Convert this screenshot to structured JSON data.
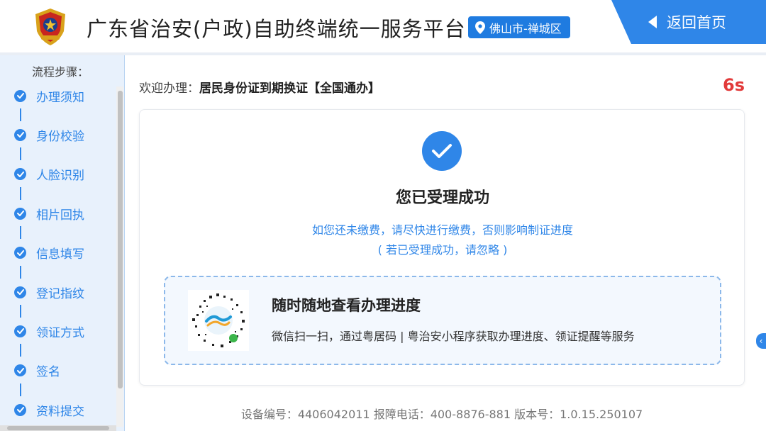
{
  "header": {
    "title": "广东省治安(户政)自助终端统一服务平台",
    "location": "佛山市-禅城区",
    "home_label": "返回首页",
    "icons": {
      "emblem": "police-emblem-icon",
      "location": "map-pin-icon",
      "back": "triangle-left-icon"
    },
    "colors": {
      "accent": "#2f86e8",
      "badge": "#1f7be0"
    }
  },
  "sidebar": {
    "heading": "流程步骤：",
    "steps": [
      {
        "label": "办理须知",
        "done": true
      },
      {
        "label": "身份校验",
        "done": true
      },
      {
        "label": "人脸识别",
        "done": true
      },
      {
        "label": "相片回执",
        "done": true
      },
      {
        "label": "信息填写",
        "done": true
      },
      {
        "label": "登记指纹",
        "done": true
      },
      {
        "label": "领证方式",
        "done": true
      },
      {
        "label": "签名",
        "done": true
      },
      {
        "label": "资料提交",
        "done": true
      }
    ]
  },
  "main": {
    "welcome_prefix": "欢迎办理：",
    "service_name": "居民身份证到期换证【全国通办】",
    "countdown": "6s",
    "success_title": "您已受理成功",
    "notice_line1": "如您还未缴费，请尽快进行缴费，否则影响制证进度",
    "notice_line2": "( 若已受理成功，请忽略 )",
    "qr_title": "随时随地查看办理进度",
    "qr_desc": "微信扫一扫，通过粤居码 | 粤治安小程序获取办理进度、领证提醒等服务"
  },
  "footer": {
    "text": "设备编号：4406042011   报障电话：400-8876-881   版本号：1.0.15.250107"
  }
}
